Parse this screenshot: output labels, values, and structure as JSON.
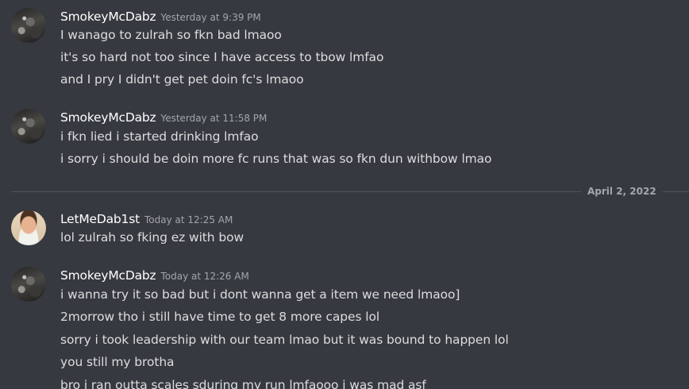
{
  "messages": [
    {
      "username": "SmokeyMcDabz",
      "timestamp": "Yesterday at 9:39 PM",
      "lines": [
        "I wanago to zulrah so fkn bad lmaoo",
        "it's so hard not too since I have access to tbow lmfao",
        "and I pry I didn't get pet doin fc's lmaoo"
      ]
    },
    {
      "username": "SmokeyMcDabz",
      "timestamp": "Yesterday at 11:58 PM",
      "lines": [
        "i fkn lied i started drinking lmfao",
        "i sorry i should be doin more fc runs that was so fkn dun withbow lmao"
      ]
    },
    {
      "username": "LetMeDab1st",
      "timestamp": "Today at 12:25 AM",
      "lines": [
        "lol zulrah so fking ez with bow"
      ]
    },
    {
      "username": "SmokeyMcDabz",
      "timestamp": "Today at 12:26 AM",
      "lines": [
        "i wanna try it so bad but i dont wanna get a item we need lmaoo]",
        "2morrow tho i still have time to get 8 more capes lol",
        "sorry i took leadership with our team lmao but it was bound to happen lol",
        "you still my brotha",
        "bro i ran outta scales sduring my run lmfaooo i was mad asf"
      ]
    }
  ],
  "date_divider": "April 2, 2022"
}
